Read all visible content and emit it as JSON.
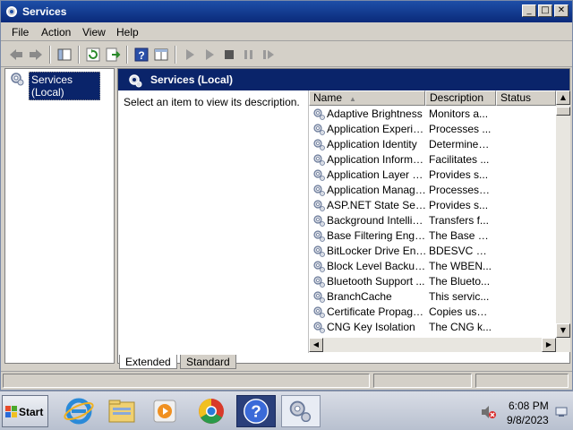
{
  "window": {
    "title": "Services",
    "minimize_glyph": "_",
    "maximize_glyph": "□",
    "close_glyph": "✕"
  },
  "menu": {
    "items": [
      "File",
      "Action",
      "View",
      "Help"
    ]
  },
  "toolbar": {
    "icons": [
      "back-arrow-icon",
      "forward-arrow-icon",
      "show-hide-console-tree-icon",
      "refresh-icon",
      "export-list-icon",
      "help-icon",
      "properties-icon",
      "start-service-icon",
      "start-service-alt-icon",
      "stop-service-icon",
      "pause-service-icon",
      "restart-service-icon"
    ]
  },
  "tree": {
    "root_label": "Services (Local)"
  },
  "main": {
    "header_title": "Services (Local)",
    "description_placeholder": "Select an item to view its description.",
    "columns": {
      "name": "Name",
      "description": "Description",
      "status": "Status"
    },
    "rows": [
      {
        "name": "Adaptive Brightness",
        "description": "Monitors a..."
      },
      {
        "name": "Application Experie...",
        "description": "Processes ..."
      },
      {
        "name": "Application Identity",
        "description": "Determines..."
      },
      {
        "name": "Application Informa...",
        "description": "Facilitates ..."
      },
      {
        "name": "Application Layer G...",
        "description": "Provides s..."
      },
      {
        "name": "Application Manage...",
        "description": "Processes i..."
      },
      {
        "name": "ASP.NET State Ser...",
        "description": "Provides s..."
      },
      {
        "name": "Background Intellig...",
        "description": "Transfers f..."
      },
      {
        "name": "Base Filtering Engine",
        "description": "The Base F..."
      },
      {
        "name": "BitLocker Drive Enc...",
        "description": "BDESVC ho..."
      },
      {
        "name": "Block Level Backup ...",
        "description": "The WBEN..."
      },
      {
        "name": "Bluetooth Support ...",
        "description": "The Blueto..."
      },
      {
        "name": "BranchCache",
        "description": "This servic..."
      },
      {
        "name": "Certificate Propaga...",
        "description": "Copies use..."
      },
      {
        "name": "CNG Key Isolation",
        "description": "The CNG k..."
      }
    ]
  },
  "tabs": {
    "extended": "Extended",
    "standard": "Standard"
  },
  "taskbar": {
    "start_label": "Start",
    "pinned": [
      "internet-explorer-icon",
      "windows-explorer-icon",
      "media-player-icon",
      "chrome-icon",
      "help-and-support-icon",
      "services-taskbar-icon"
    ],
    "clock_time": "6:08 PM",
    "clock_date": "9/8/2023"
  },
  "colors": {
    "title_bar": "#0a246a",
    "selection": "#0a246a",
    "chrome_gray": "#d4d0c8"
  }
}
